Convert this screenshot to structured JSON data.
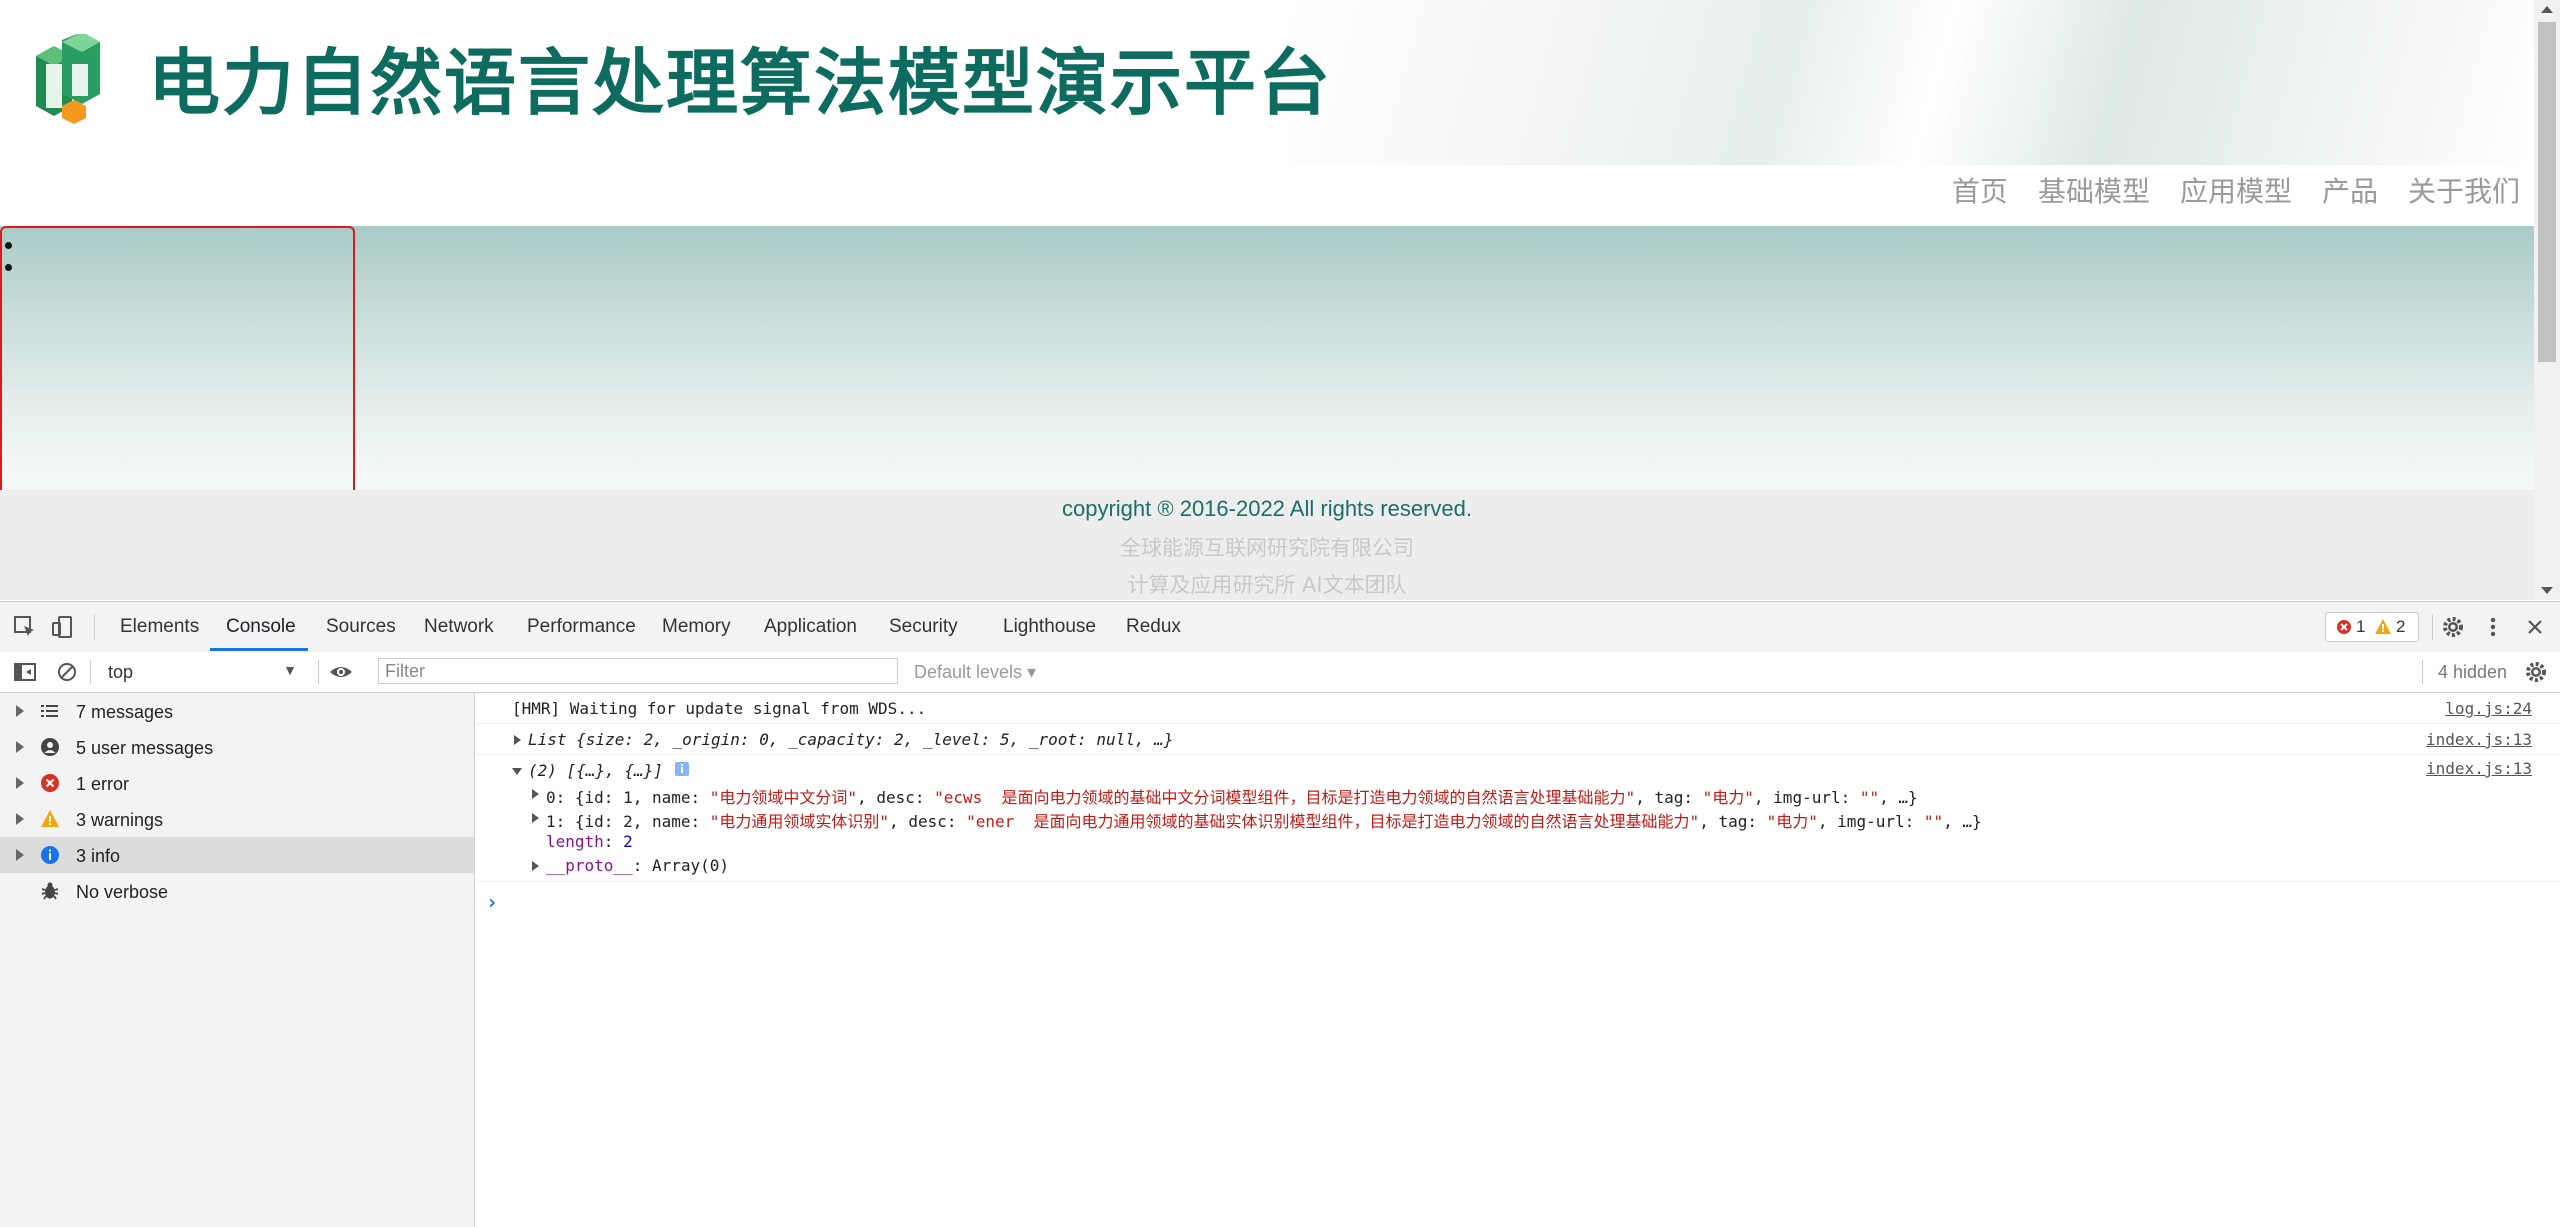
{
  "site": {
    "title": "电力自然语言处理算法模型演示平台",
    "nav": [
      "首页",
      "基础模型",
      "应用模型",
      "产品",
      "关于我们"
    ],
    "footer": {
      "copyright": "copyright ® 2016-2022 All rights reserved.",
      "org": "全球能源互联网研究院有限公司",
      "team": "计算及应用研究所 AI文本团队"
    },
    "colors": {
      "brand": "#0e6b60",
      "outline": "#e01818"
    }
  },
  "devtools": {
    "tabs": [
      "Elements",
      "Console",
      "Sources",
      "Network",
      "Performance",
      "Memory",
      "Application",
      "Security",
      "Lighthouse",
      "Redux"
    ],
    "active_tab": "Console",
    "errors": "1",
    "warnings": "2",
    "context": "top",
    "filter_placeholder": "Filter",
    "levels": "Default levels ▾",
    "hidden": "4 hidden",
    "sidebar": [
      {
        "label": "7 messages",
        "icon": "list-icon"
      },
      {
        "label": "5 user messages",
        "icon": "user-icon"
      },
      {
        "label": "1 error",
        "icon": "error-icon"
      },
      {
        "label": "3 warnings",
        "icon": "warning-icon"
      },
      {
        "label": "3 info",
        "icon": "info-icon"
      },
      {
        "label": "No verbose",
        "icon": "bug-icon"
      }
    ],
    "logs": {
      "hmr": {
        "text": "[HMR] Waiting for update signal from WDS...",
        "src": "log.js:24"
      },
      "list": {
        "text": "List {size: 2, _origin: 0, _capacity: 2, _level: 5, _root: null, …}",
        "src": "index.js:13"
      },
      "array": {
        "header": "(2) [{…}, {…}]",
        "src": "index.js:13",
        "item0": {
          "prefix": "0: {id: 1, name: ",
          "name": "\"电力领域中文分词\"",
          "desc_label": ", desc: ",
          "desc": "\"ecws  是面向电力领域的基础中文分词模型组件，目标是打造电力领域的自然语言处理基础能力\"",
          "tag_label": ", tag: ",
          "tag": "\"电力\"",
          "img_label": ", img-url: ",
          "img": "\"\"",
          "suffix": ", …}"
        },
        "item1": {
          "prefix": "1: {id: 2, name: ",
          "name": "\"电力通用领域实体识别\"",
          "desc_label": ", desc: ",
          "desc": "\"ener  是面向电力通用领域的基础实体识别模型组件，目标是打造电力领域的自然语言处理基础能力\"",
          "tag_label": ", tag: ",
          "tag": "\"电力\"",
          "img_label": ", img-url: ",
          "img": "\"\"",
          "suffix": ", …}"
        },
        "length_key": "length",
        "length_val": "2",
        "proto_key": "__proto__",
        "proto_val": ": Array(0)"
      },
      "prompt": "›"
    }
  }
}
